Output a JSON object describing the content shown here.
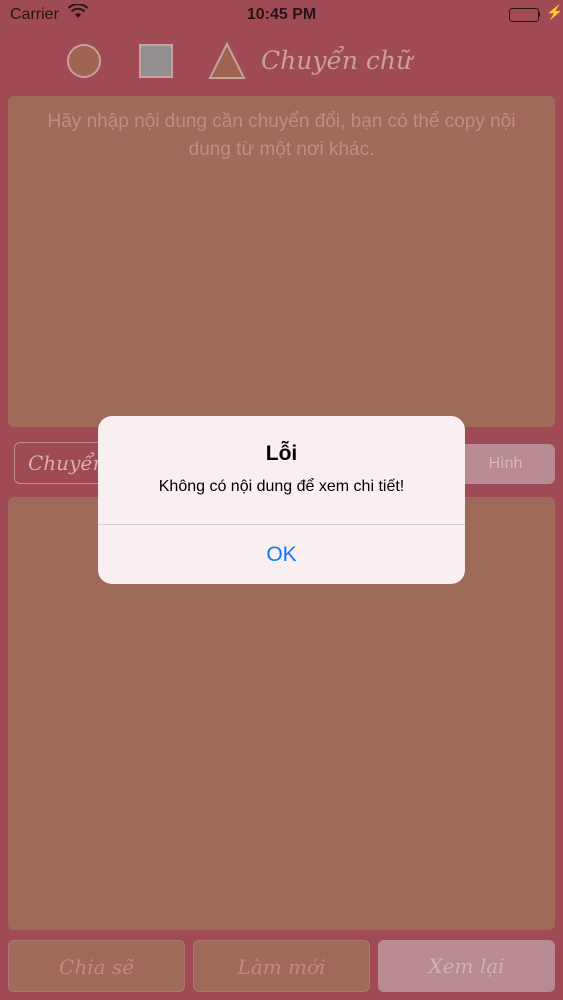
{
  "status": {
    "carrier": "Carrier",
    "time": "10:45 PM"
  },
  "toolbar": {
    "title": "Chuyển chữ",
    "icons": [
      "circle-shape",
      "square-shape",
      "triangle-shape"
    ]
  },
  "input": {
    "placeholder": "Hãy nhập nội dung cần chuyển đổi, bạn có thể copy nội dung từ một nơi khác."
  },
  "controls": {
    "convert_label": "Chuyển",
    "image_label": "Hình"
  },
  "bottom": {
    "share_label": "Chia sẽ",
    "refresh_label": "Làm mới",
    "review_label": "Xem lại"
  },
  "alert": {
    "title": "Lỗi",
    "message": "Không có nội dung để xem chi tiết!",
    "ok_label": "OK"
  },
  "colors": {
    "background": "#a04a56",
    "alert_button": "#0a7aff"
  }
}
